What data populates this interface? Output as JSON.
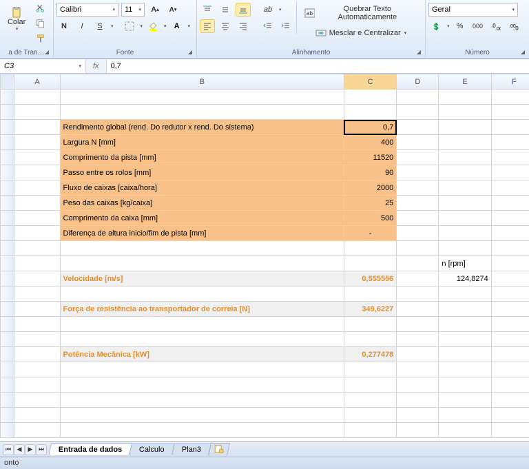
{
  "ribbon": {
    "clipboard": {
      "paste": "Colar",
      "group": "a de Tran…"
    },
    "font": {
      "name": "Calibri",
      "size": "11",
      "group": "Fonte",
      "bold": "N",
      "italic": "I",
      "underline": "S"
    },
    "alignment": {
      "wrap": "Quebrar Texto Automaticamente",
      "merge": "Mesclar e Centralizar",
      "group": "Alinhamento"
    },
    "number": {
      "format": "Geral",
      "group": "Número",
      "percent": "%",
      "thousands": "000"
    }
  },
  "formula": {
    "cell": "C3",
    "fx": "fx",
    "value": "0,7"
  },
  "cols": [
    "A",
    "B",
    "C",
    "D",
    "E",
    "F"
  ],
  "rows": [
    {
      "b": "",
      "c": "",
      "cls": ""
    },
    {
      "b": "",
      "c": "",
      "cls": ""
    },
    {
      "b": "Rendimento global (rend. Do redutor x rend. Do sistema)",
      "c": "0,7",
      "cls": "orange",
      "sel": true
    },
    {
      "b": "Largura N [mm]",
      "c": "400",
      "cls": "orange"
    },
    {
      "b": "Comprimento da pista [mm]",
      "c": "11520",
      "cls": "orange"
    },
    {
      "b": "Passo entre os rolos [mm]",
      "c": "90",
      "cls": "orange"
    },
    {
      "b": "Fluxo de caixas [caixa/hora]",
      "c": "2000",
      "cls": "orange"
    },
    {
      "b": "Peso das caixas [kg/caixa]",
      "c": "25",
      "cls": "orange"
    },
    {
      "b": "Comprimento da caixa [mm]",
      "c": "500",
      "cls": "orange"
    },
    {
      "b": "Diferença de altura inicio/fim de pista [mm]",
      "c": "-",
      "cls": "orange",
      "ct": true
    },
    {
      "b": "",
      "c": ""
    },
    {
      "b": "",
      "c": "",
      "e": "n [rpm]"
    },
    {
      "b": "Velocidade [m/s]",
      "c": "0,555556",
      "cls": "grey",
      "e": "124,8274"
    },
    {
      "b": "",
      "c": ""
    },
    {
      "b": "Força de resistência ao transportador de correia [N]",
      "c": "349,6227",
      "cls": "grey"
    },
    {
      "b": "",
      "c": ""
    },
    {
      "b": "",
      "c": ""
    },
    {
      "b": "Potência Mecânica [kW]",
      "c": "0,277478",
      "cls": "grey"
    },
    {
      "b": "",
      "c": ""
    },
    {
      "b": "",
      "c": ""
    },
    {
      "b": "",
      "c": ""
    },
    {
      "b": "",
      "c": ""
    },
    {
      "b": "",
      "c": ""
    }
  ],
  "tabs": {
    "t1": "Entrada de dados",
    "t2": "Calculo",
    "t3": "Plan3"
  },
  "status": "onto"
}
